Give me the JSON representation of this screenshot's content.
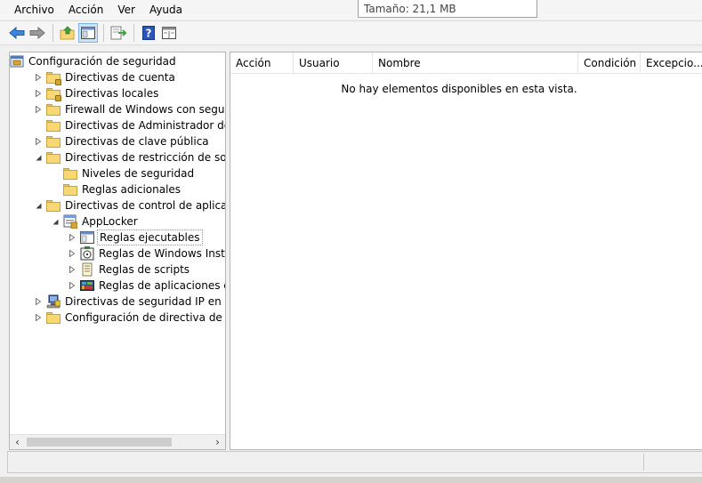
{
  "menubar": {
    "items": [
      {
        "label": "Archivo"
      },
      {
        "label": "Acción"
      },
      {
        "label": "Ver"
      },
      {
        "label": "Ayuda"
      }
    ]
  },
  "tooltip": {
    "text": "Tamaño: 21,1 MB"
  },
  "toolbar": {
    "buttons": [
      {
        "icon": "back-arrow-icon"
      },
      {
        "icon": "forward-arrow-icon"
      },
      {
        "icon": "up-folder-icon"
      },
      {
        "icon": "show-hide-tree-icon"
      },
      {
        "icon": "export-list-icon"
      },
      {
        "icon": "help-icon"
      },
      {
        "icon": "properties-icon"
      }
    ]
  },
  "tree": {
    "nodes": [
      {
        "label": "Configuración de seguridad",
        "icon": "security-settings-icon",
        "expander": ""
      },
      {
        "label": "Directivas de cuenta",
        "icon": "locked-folder-icon",
        "expander": "collapsed"
      },
      {
        "label": "Directivas locales",
        "icon": "locked-folder-icon",
        "expander": "collapsed"
      },
      {
        "label": "Firewall de Windows con seguridad av",
        "icon": "folder-icon",
        "expander": "collapsed"
      },
      {
        "label": "Directivas de Administrador de listas d",
        "icon": "folder-icon",
        "expander": ""
      },
      {
        "label": "Directivas de clave pública",
        "icon": "folder-icon",
        "expander": "collapsed"
      },
      {
        "label": "Directivas de restricción de software",
        "icon": "folder-icon",
        "expander": "expanded"
      },
      {
        "label": "Niveles de seguridad",
        "icon": "folder-icon",
        "expander": ""
      },
      {
        "label": "Reglas adicionales",
        "icon": "folder-icon",
        "expander": ""
      },
      {
        "label": "Directivas de control de aplicaciones",
        "icon": "folder-icon",
        "expander": "expanded"
      },
      {
        "label": "AppLocker",
        "icon": "applocker-icon",
        "expander": "expanded"
      },
      {
        "label": "Reglas ejecutables",
        "icon": "executable-rules-icon",
        "expander": "collapsed",
        "selected": true
      },
      {
        "label": "Reglas de Windows Installer",
        "icon": "windows-installer-icon",
        "expander": "collapsed"
      },
      {
        "label": "Reglas de scripts",
        "icon": "script-rules-icon",
        "expander": "collapsed"
      },
      {
        "label": "Reglas de aplicaciones empaq",
        "icon": "packaged-apps-icon",
        "expander": "collapsed"
      },
      {
        "label": "Directivas de seguridad IP en Equipo l",
        "icon": "ip-security-icon",
        "expander": "collapsed"
      },
      {
        "label": "Configuración de directiva de auditor",
        "icon": "folder-icon",
        "expander": "collapsed"
      }
    ]
  },
  "list": {
    "columns": [
      {
        "label": "Acción"
      },
      {
        "label": "Usuario"
      },
      {
        "label": "Nombre"
      },
      {
        "label": "Condición"
      },
      {
        "label": "Excepcio..."
      }
    ],
    "empty_message": "No hay elementos disponibles en esta vista."
  },
  "colors": {
    "accent": "#2a6ec2",
    "folder": "#f8d775",
    "window_bg": "#f0f0f0"
  }
}
